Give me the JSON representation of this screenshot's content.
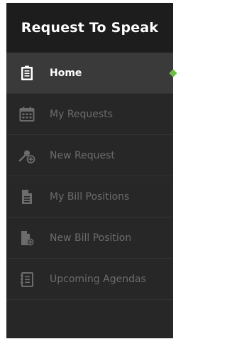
{
  "app": {
    "title": "Request To Speak"
  },
  "menu": {
    "items": [
      {
        "label": "Home",
        "icon": "clipboard-icon",
        "active": true
      },
      {
        "label": "My Requests",
        "icon": "calendar-icon",
        "active": false
      },
      {
        "label": "New Request",
        "icon": "microphone-plus-icon",
        "active": false
      },
      {
        "label": "My Bill Positions",
        "icon": "document-icon",
        "active": false
      },
      {
        "label": "New Bill Position",
        "icon": "document-plus-icon",
        "active": false
      },
      {
        "label": "Upcoming Agendas",
        "icon": "agenda-icon",
        "active": false
      }
    ]
  },
  "colors": {
    "background": "#272727",
    "header": "#1d1d1d",
    "active_background": "#3a3a3a",
    "active_text": "#ffffff",
    "inactive_text": "#6c6c6c",
    "accent": "#6dbd45"
  }
}
